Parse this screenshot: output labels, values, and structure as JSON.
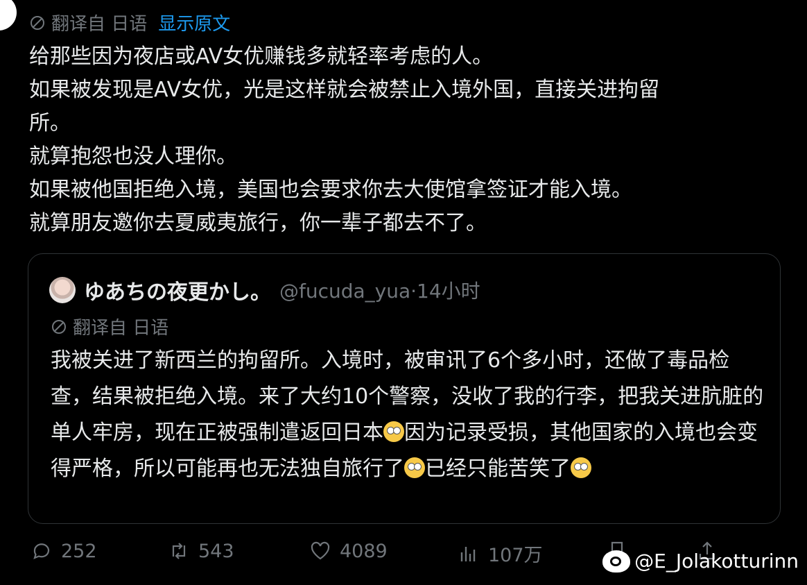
{
  "post": {
    "translated_from": "翻译自 日语",
    "show_original": "显示原文",
    "lines": [
      "给那些因为夜店或AV女优赚钱多就轻率考虑的人。",
      "如果被发现是AV女优，光是这样就会被禁止入境外国，直接关进拘留",
      "所。",
      "就算抱怨也没人理你。",
      "如果被他国拒绝入境，美国也会要求你去大使馆拿签证才能入境。",
      "就算朋友邀你去夏威夷旅行，你一辈子都去不了。"
    ]
  },
  "quote": {
    "name": "ゆあちの夜更かし。",
    "handle": "@fucuda_yua",
    "time": "·14小时",
    "translated_from": "翻译自 日语",
    "text_part1": "我被关进了新西兰的拘留所。入境时，被审讯了6个多小时，还做了毒品检查，结果被拒绝入境。来了大约10个警察，没收了我的行李，把我关进肮脏的单人牢房，现在正被强制遣返回日本",
    "text_part2": "因为记录受损，其他国家的入境也会变得严格，所以可能再也无法独自旅行了",
    "text_part3": "已经只能苦笑了"
  },
  "actions": {
    "replies": "252",
    "reposts": "543",
    "likes": "4089",
    "views": "107万"
  },
  "watermark": "@E_Jolakotturinn",
  "icons": [
    "globe-icon",
    "reply-icon",
    "repost-icon",
    "like-icon",
    "views-icon",
    "bookmark-icon",
    "share-icon",
    "eye-roll-emoji",
    "laughing-emoji",
    "weibo-logo"
  ]
}
